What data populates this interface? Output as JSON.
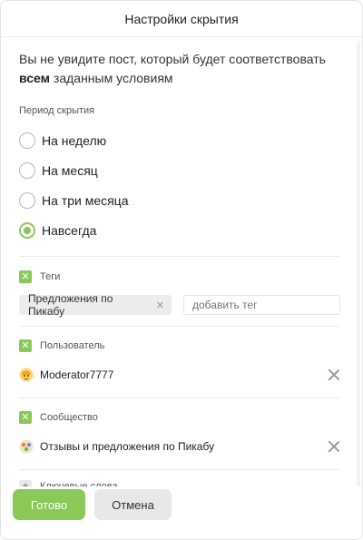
{
  "dialog": {
    "title": "Настройки скрытия"
  },
  "intro": {
    "text_before": "Вы не увидите пост, который будет соответствовать ",
    "text_bold": "всем",
    "text_after": " заданным условиям"
  },
  "period": {
    "label": "Период скрытия",
    "options": [
      {
        "label": "На неделю",
        "selected": false
      },
      {
        "label": "На месяц",
        "selected": false
      },
      {
        "label": "На три месяца",
        "selected": false
      },
      {
        "label": "Навсегда",
        "selected": true
      }
    ]
  },
  "tags": {
    "label": "Теги",
    "checked": true,
    "chip": "Предложения по Пикабу",
    "input_placeholder": "добавить тег"
  },
  "user": {
    "label": "Пользователь",
    "checked": true,
    "name": "Moderator7777",
    "avatar_icon": "moderator-avatar-icon"
  },
  "community": {
    "label": "Сообщество",
    "checked": true,
    "name": "Отзывы и предложения по Пикабу",
    "avatar_icon": "community-avatar-icon"
  },
  "keywords": {
    "label": "Ключевые слова",
    "checked": false
  },
  "footer": {
    "ok_label": "Готово",
    "cancel_label": "Отмена"
  },
  "colors": {
    "accent": "#8ac858",
    "secondary_button": "#e8e8e8"
  }
}
